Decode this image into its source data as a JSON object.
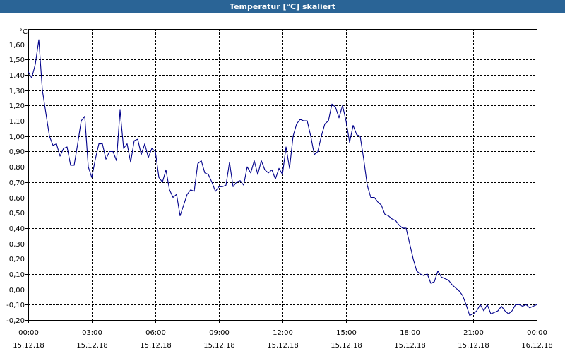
{
  "window": {
    "title": "Temperatur [°C] skaliert"
  },
  "colors": {
    "titlebar": "#2a6496",
    "series": "#00008b",
    "grid": "#000000",
    "background": "#ffffff"
  },
  "chart_data": {
    "type": "line",
    "title": "Temperatur [°C] skaliert",
    "ylabel": "°C",
    "xlabel": "",
    "ylim": [
      -0.2,
      1.7
    ],
    "yticks": [
      -0.2,
      -0.1,
      0.0,
      0.1,
      0.2,
      0.3,
      0.4,
      0.5,
      0.6,
      0.7,
      0.8,
      0.9,
      1.0,
      1.1,
      1.2,
      1.3,
      1.4,
      1.5,
      1.6
    ],
    "ytick_labels": [
      "-0,20",
      "-0,10",
      "0,00",
      "0,10",
      "0,20",
      "0,30",
      "0,40",
      "0,50",
      "0,60",
      "0,70",
      "0,80",
      "0,90",
      "1,00",
      "1,10",
      "1,20",
      "1,30",
      "1,40",
      "1,50",
      "1,60"
    ],
    "xlim": [
      "15.12.18 00:00",
      "16.12.18 00:00"
    ],
    "xticks": [
      {
        "time": "00:00",
        "date": "15.12.18"
      },
      {
        "time": "03:00",
        "date": "15.12.18"
      },
      {
        "time": "06:00",
        "date": "15.12.18"
      },
      {
        "time": "09:00",
        "date": "15.12.18"
      },
      {
        "time": "12:00",
        "date": "15.12.18"
      },
      {
        "time": "15:00",
        "date": "15.12.18"
      },
      {
        "time": "18:00",
        "date": "15.12.18"
      },
      {
        "time": "21:00",
        "date": "15.12.18"
      },
      {
        "time": "00:00",
        "date": "16.12.18"
      }
    ],
    "grid": true,
    "series": [
      {
        "x": [
          "15.12.18 00:00",
          "15.12.18 00:10",
          "15.12.18 00:20",
          "15.12.18 00:30",
          "15.12.18 00:40",
          "15.12.18 00:50",
          "15.12.18 01:00",
          "15.12.18 01:10",
          "15.12.18 01:20",
          "15.12.18 01:30",
          "15.12.18 01:40",
          "15.12.18 01:50",
          "15.12.18 02:00",
          "15.12.18 02:10",
          "15.12.18 02:20",
          "15.12.18 02:30",
          "15.12.18 02:40",
          "15.12.18 02:50",
          "15.12.18 03:00",
          "15.12.18 03:10",
          "15.12.18 03:20",
          "15.12.18 03:30",
          "15.12.18 03:40",
          "15.12.18 03:50",
          "15.12.18 04:00",
          "15.12.18 04:10",
          "15.12.18 04:20",
          "15.12.18 04:30",
          "15.12.18 04:40",
          "15.12.18 04:50",
          "15.12.18 05:00",
          "15.12.18 05:10",
          "15.12.18 05:20",
          "15.12.18 05:30",
          "15.12.18 05:40",
          "15.12.18 05:50",
          "15.12.18 06:00",
          "15.12.18 06:10",
          "15.12.18 06:20",
          "15.12.18 06:30",
          "15.12.18 06:40",
          "15.12.18 06:50",
          "15.12.18 07:00",
          "15.12.18 07:10",
          "15.12.18 07:20",
          "15.12.18 07:30",
          "15.12.18 07:40",
          "15.12.18 07:50",
          "15.12.18 08:00",
          "15.12.18 08:10",
          "15.12.18 08:20",
          "15.12.18 08:30",
          "15.12.18 08:40",
          "15.12.18 08:50",
          "15.12.18 09:00",
          "15.12.18 09:10",
          "15.12.18 09:20",
          "15.12.18 09:30",
          "15.12.18 09:40",
          "15.12.18 09:50",
          "15.12.18 10:00",
          "15.12.18 10:10",
          "15.12.18 10:20",
          "15.12.18 10:30",
          "15.12.18 10:40",
          "15.12.18 10:50",
          "15.12.18 11:00",
          "15.12.18 11:10",
          "15.12.18 11:20",
          "15.12.18 11:30",
          "15.12.18 11:40",
          "15.12.18 11:50",
          "15.12.18 12:00",
          "15.12.18 12:10",
          "15.12.18 12:20",
          "15.12.18 12:30",
          "15.12.18 12:40",
          "15.12.18 12:50",
          "15.12.18 13:00",
          "15.12.18 13:10",
          "15.12.18 13:20",
          "15.12.18 13:30",
          "15.12.18 13:40",
          "15.12.18 13:50",
          "15.12.18 14:00",
          "15.12.18 14:10",
          "15.12.18 14:20",
          "15.12.18 14:30",
          "15.12.18 14:40",
          "15.12.18 14:50",
          "15.12.18 15:00",
          "15.12.18 15:10",
          "15.12.18 15:20",
          "15.12.18 15:30",
          "15.12.18 15:40",
          "15.12.18 15:50",
          "15.12.18 16:00",
          "15.12.18 16:10",
          "15.12.18 16:20",
          "15.12.18 16:30",
          "15.12.18 16:40",
          "15.12.18 16:50",
          "15.12.18 17:00",
          "15.12.18 17:10",
          "15.12.18 17:20",
          "15.12.18 17:30",
          "15.12.18 17:40",
          "15.12.18 17:50",
          "15.12.18 18:00",
          "15.12.18 18:10",
          "15.12.18 18:20",
          "15.12.18 18:30",
          "15.12.18 18:40",
          "15.12.18 18:50",
          "15.12.18 19:00",
          "15.12.18 19:10",
          "15.12.18 19:20",
          "15.12.18 19:30",
          "15.12.18 19:40",
          "15.12.18 19:50",
          "15.12.18 20:00",
          "15.12.18 20:10",
          "15.12.18 20:20",
          "15.12.18 20:30",
          "15.12.18 20:40",
          "15.12.18 20:50",
          "15.12.18 21:00",
          "15.12.18 21:10",
          "15.12.18 21:20",
          "15.12.18 21:30",
          "15.12.18 21:40",
          "15.12.18 21:50",
          "15.12.18 22:00",
          "15.12.18 22:10",
          "15.12.18 22:20",
          "15.12.18 22:30",
          "15.12.18 22:40",
          "15.12.18 22:50",
          "15.12.18 23:00",
          "15.12.18 23:10",
          "15.12.18 23:20",
          "15.12.18 23:30",
          "15.12.18 23:40",
          "15.12.18 23:50",
          "16.12.18 00:00"
        ],
        "values": [
          1.42,
          1.38,
          1.47,
          1.63,
          1.3,
          1.15,
          1.0,
          0.94,
          0.95,
          0.87,
          0.92,
          0.93,
          0.81,
          0.81,
          0.95,
          1.1,
          1.13,
          0.8,
          0.73,
          0.85,
          0.95,
          0.95,
          0.85,
          0.9,
          0.9,
          0.84,
          1.17,
          0.92,
          0.95,
          0.83,
          0.97,
          0.98,
          0.88,
          0.95,
          0.86,
          0.92,
          0.9,
          0.73,
          0.7,
          0.78,
          0.65,
          0.6,
          0.62,
          0.48,
          0.55,
          0.62,
          0.65,
          0.64,
          0.82,
          0.84,
          0.76,
          0.75,
          0.7,
          0.64,
          0.67,
          0.67,
          0.68,
          0.83,
          0.67,
          0.7,
          0.71,
          0.68,
          0.8,
          0.76,
          0.84,
          0.75,
          0.84,
          0.78,
          0.76,
          0.78,
          0.72,
          0.79,
          0.75,
          0.93,
          0.79,
          1.0,
          1.08,
          1.11,
          1.1,
          1.1,
          1.0,
          0.88,
          0.9,
          1.0,
          1.08,
          1.1,
          1.21,
          1.19,
          1.12,
          1.2,
          1.1,
          0.96,
          1.07,
          1.01,
          1.0,
          0.85,
          0.68,
          0.6,
          0.6,
          0.57,
          0.55,
          0.49,
          0.48,
          0.46,
          0.45,
          0.42,
          0.4,
          0.4,
          0.3,
          0.2,
          0.12,
          0.1,
          0.09,
          0.1,
          0.04,
          0.05,
          0.12,
          0.08,
          0.07,
          0.06,
          0.03,
          0.01,
          -0.01,
          -0.04,
          -0.1,
          -0.17,
          -0.16,
          -0.14,
          -0.1,
          -0.14,
          -0.1,
          -0.16,
          -0.15,
          -0.14,
          -0.11,
          -0.14,
          -0.16,
          -0.14,
          -0.1,
          -0.1,
          -0.11,
          -0.1,
          -0.12,
          -0.11,
          -0.1
        ]
      }
    ]
  }
}
